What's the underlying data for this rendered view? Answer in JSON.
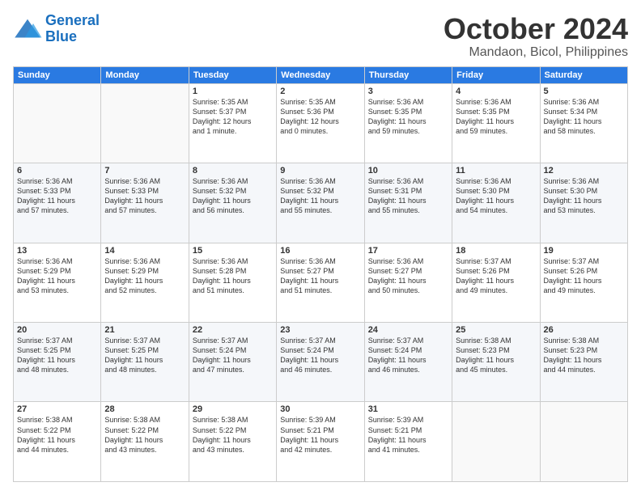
{
  "header": {
    "logo_line1": "General",
    "logo_line2": "Blue",
    "month": "October 2024",
    "location": "Mandaon, Bicol, Philippines"
  },
  "days_of_week": [
    "Sunday",
    "Monday",
    "Tuesday",
    "Wednesday",
    "Thursday",
    "Friday",
    "Saturday"
  ],
  "weeks": [
    [
      {
        "day": "",
        "detail": ""
      },
      {
        "day": "",
        "detail": ""
      },
      {
        "day": "1",
        "detail": "Sunrise: 5:35 AM\nSunset: 5:37 PM\nDaylight: 12 hours\nand 1 minute."
      },
      {
        "day": "2",
        "detail": "Sunrise: 5:35 AM\nSunset: 5:36 PM\nDaylight: 12 hours\nand 0 minutes."
      },
      {
        "day": "3",
        "detail": "Sunrise: 5:36 AM\nSunset: 5:35 PM\nDaylight: 11 hours\nand 59 minutes."
      },
      {
        "day": "4",
        "detail": "Sunrise: 5:36 AM\nSunset: 5:35 PM\nDaylight: 11 hours\nand 59 minutes."
      },
      {
        "day": "5",
        "detail": "Sunrise: 5:36 AM\nSunset: 5:34 PM\nDaylight: 11 hours\nand 58 minutes."
      }
    ],
    [
      {
        "day": "6",
        "detail": "Sunrise: 5:36 AM\nSunset: 5:33 PM\nDaylight: 11 hours\nand 57 minutes."
      },
      {
        "day": "7",
        "detail": "Sunrise: 5:36 AM\nSunset: 5:33 PM\nDaylight: 11 hours\nand 57 minutes."
      },
      {
        "day": "8",
        "detail": "Sunrise: 5:36 AM\nSunset: 5:32 PM\nDaylight: 11 hours\nand 56 minutes."
      },
      {
        "day": "9",
        "detail": "Sunrise: 5:36 AM\nSunset: 5:32 PM\nDaylight: 11 hours\nand 55 minutes."
      },
      {
        "day": "10",
        "detail": "Sunrise: 5:36 AM\nSunset: 5:31 PM\nDaylight: 11 hours\nand 55 minutes."
      },
      {
        "day": "11",
        "detail": "Sunrise: 5:36 AM\nSunset: 5:30 PM\nDaylight: 11 hours\nand 54 minutes."
      },
      {
        "day": "12",
        "detail": "Sunrise: 5:36 AM\nSunset: 5:30 PM\nDaylight: 11 hours\nand 53 minutes."
      }
    ],
    [
      {
        "day": "13",
        "detail": "Sunrise: 5:36 AM\nSunset: 5:29 PM\nDaylight: 11 hours\nand 53 minutes."
      },
      {
        "day": "14",
        "detail": "Sunrise: 5:36 AM\nSunset: 5:29 PM\nDaylight: 11 hours\nand 52 minutes."
      },
      {
        "day": "15",
        "detail": "Sunrise: 5:36 AM\nSunset: 5:28 PM\nDaylight: 11 hours\nand 51 minutes."
      },
      {
        "day": "16",
        "detail": "Sunrise: 5:36 AM\nSunset: 5:27 PM\nDaylight: 11 hours\nand 51 minutes."
      },
      {
        "day": "17",
        "detail": "Sunrise: 5:36 AM\nSunset: 5:27 PM\nDaylight: 11 hours\nand 50 minutes."
      },
      {
        "day": "18",
        "detail": "Sunrise: 5:37 AM\nSunset: 5:26 PM\nDaylight: 11 hours\nand 49 minutes."
      },
      {
        "day": "19",
        "detail": "Sunrise: 5:37 AM\nSunset: 5:26 PM\nDaylight: 11 hours\nand 49 minutes."
      }
    ],
    [
      {
        "day": "20",
        "detail": "Sunrise: 5:37 AM\nSunset: 5:25 PM\nDaylight: 11 hours\nand 48 minutes."
      },
      {
        "day": "21",
        "detail": "Sunrise: 5:37 AM\nSunset: 5:25 PM\nDaylight: 11 hours\nand 48 minutes."
      },
      {
        "day": "22",
        "detail": "Sunrise: 5:37 AM\nSunset: 5:24 PM\nDaylight: 11 hours\nand 47 minutes."
      },
      {
        "day": "23",
        "detail": "Sunrise: 5:37 AM\nSunset: 5:24 PM\nDaylight: 11 hours\nand 46 minutes."
      },
      {
        "day": "24",
        "detail": "Sunrise: 5:37 AM\nSunset: 5:24 PM\nDaylight: 11 hours\nand 46 minutes."
      },
      {
        "day": "25",
        "detail": "Sunrise: 5:38 AM\nSunset: 5:23 PM\nDaylight: 11 hours\nand 45 minutes."
      },
      {
        "day": "26",
        "detail": "Sunrise: 5:38 AM\nSunset: 5:23 PM\nDaylight: 11 hours\nand 44 minutes."
      }
    ],
    [
      {
        "day": "27",
        "detail": "Sunrise: 5:38 AM\nSunset: 5:22 PM\nDaylight: 11 hours\nand 44 minutes."
      },
      {
        "day": "28",
        "detail": "Sunrise: 5:38 AM\nSunset: 5:22 PM\nDaylight: 11 hours\nand 43 minutes."
      },
      {
        "day": "29",
        "detail": "Sunrise: 5:38 AM\nSunset: 5:22 PM\nDaylight: 11 hours\nand 43 minutes."
      },
      {
        "day": "30",
        "detail": "Sunrise: 5:39 AM\nSunset: 5:21 PM\nDaylight: 11 hours\nand 42 minutes."
      },
      {
        "day": "31",
        "detail": "Sunrise: 5:39 AM\nSunset: 5:21 PM\nDaylight: 11 hours\nand 41 minutes."
      },
      {
        "day": "",
        "detail": ""
      },
      {
        "day": "",
        "detail": ""
      }
    ]
  ]
}
